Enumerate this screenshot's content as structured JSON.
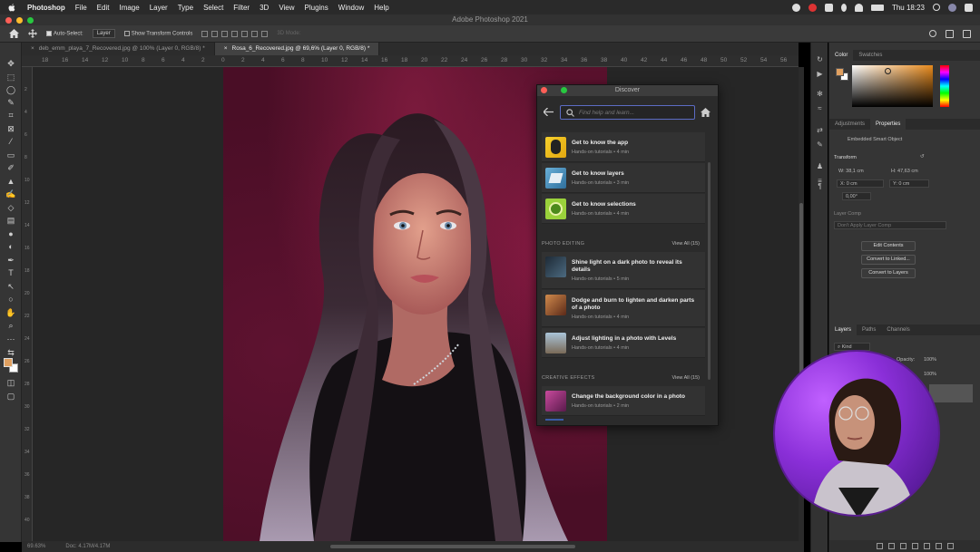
{
  "menubar": {
    "app_name": "Photoshop",
    "items": [
      "File",
      "Edit",
      "Image",
      "Layer",
      "Type",
      "Select",
      "Filter",
      "3D",
      "View",
      "Plugins",
      "Window",
      "Help"
    ],
    "clock": "Thu 18:23"
  },
  "window": {
    "title": "Adobe Photoshop 2021"
  },
  "options": {
    "auto_select_label": "Auto-Select:",
    "auto_select_target": "Layer",
    "transform_controls_label": "Show Transform Controls",
    "mode_label": "3D Mode:"
  },
  "tabs": [
    {
      "label": "deb_emm_playa_7_Recovered.jpg @ 100% (Layer 0, RGB/8) *"
    },
    {
      "label": "Rosa_6_Recovered.jpg @ 69,6% (Layer 0, RGB/8) *"
    }
  ],
  "ruler": {
    "h_labels": [
      "18",
      "16",
      "14",
      "12",
      "10",
      "8",
      "6",
      "4",
      "2",
      "0",
      "2",
      "4",
      "6",
      "8",
      "10",
      "12",
      "14",
      "16",
      "18",
      "20",
      "22",
      "24",
      "26",
      "28",
      "30",
      "32",
      "34",
      "36",
      "38",
      "40",
      "42",
      "44",
      "46",
      "48",
      "50",
      "52",
      "54",
      "56"
    ],
    "v_labels": [
      "2",
      "4",
      "6",
      "8",
      "10",
      "12",
      "14",
      "16",
      "18",
      "20",
      "22",
      "24",
      "26",
      "28",
      "30",
      "32",
      "34",
      "36",
      "38",
      "40"
    ]
  },
  "status": {
    "zoom": "69.63%",
    "doc": "Doc: 4.17M/4.17M"
  },
  "discover": {
    "title": "Discover",
    "search_placeholder": "Find help and learn...",
    "getting_started": [
      {
        "title": "Get to know the app",
        "meta": "Hands-on tutorials  •  4 min"
      },
      {
        "title": "Get to know layers",
        "meta": "Hands-on tutorials  •  3 min"
      },
      {
        "title": "Get to know selections",
        "meta": "Hands-on tutorials  •  4 min"
      }
    ],
    "photo_editing": {
      "heading": "PHOTO EDITING",
      "view_all": "View All (15)",
      "items": [
        {
          "title": "Shine light on a dark photo to reveal its details",
          "meta": "Hands-on tutorials  •  5 min"
        },
        {
          "title": "Dodge and burn to lighten and darken parts of a photo",
          "meta": "Hands-on tutorials  •  4 min"
        },
        {
          "title": "Adjust lighting in a photo with Levels",
          "meta": "Hands-on tutorials  •  4 min"
        }
      ]
    },
    "creative_effects": {
      "heading": "CREATIVE EFFECTS",
      "view_all": "View All (15)",
      "items": [
        {
          "title": "Change the background color in a photo",
          "meta": "Hands-on tutorials  •  2 min"
        }
      ]
    }
  },
  "panels": {
    "color_tabs": [
      "Color",
      "Swatches"
    ],
    "props_tabs": [
      "Adjustments",
      "Properties"
    ],
    "smart_object": "Embedded Smart Object",
    "transform_label": "Transform",
    "w": "W: 38,1 cm",
    "h": "H: 47,63 cm",
    "x": "X: 0 cm",
    "y": "Y: 0 cm",
    "angle": "0,00°",
    "layer_comp_label": "Layer Comp",
    "layer_comp_value": "Don't Apply Layer Comp",
    "btn_edit": "Edit Contents",
    "btn_convert_linked": "Convert to Linked...",
    "btn_convert_layers": "Convert to Layers",
    "layers_tabs": [
      "Layers",
      "Paths",
      "Channels"
    ],
    "kind": "Kind",
    "opacity_label": "Opacity:",
    "opacity": "100%",
    "fill": "100%"
  },
  "colors": {
    "foreground": "#e0a060",
    "accent_search": "#5c6cc4"
  }
}
